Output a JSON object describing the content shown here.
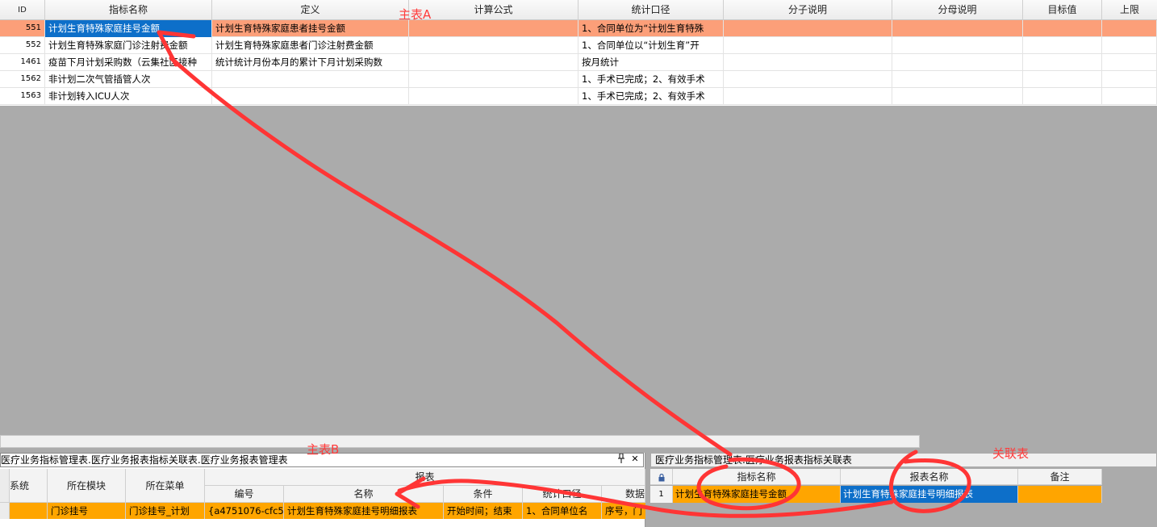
{
  "grid_a": {
    "columns": [
      "ID",
      "指标名称",
      "定义",
      "计算公式",
      "统计口径",
      "分子说明",
      "分母说明",
      "目标值",
      "上限"
    ],
    "rows": [
      {
        "id": "551",
        "name": "计划生育特殊家庭挂号金额",
        "definition": "计划生育特殊家庭患者挂号金额",
        "formula": "",
        "scope": "1、合同单位为“计划生育特殊"
      },
      {
        "id": "552",
        "name": "计划生育特殊家庭门诊注射费金额",
        "definition": "计划生育特殊家庭患者门诊注射费金额",
        "formula": "",
        "scope": "1、合同单位以“计划生育”开"
      },
      {
        "id": "1461",
        "name": "疫苗下月计划采购数（云集社区接种",
        "definition": "统计统计月份本月的累计下月计划采购数",
        "formula": "",
        "scope": "按月统计"
      },
      {
        "id": "1562",
        "name": "非计划二次气管插管人次",
        "definition": "",
        "formula": "",
        "scope": "1、手术已完成；2、有效手术"
      },
      {
        "id": "1563",
        "name": "非计划转入ICU人次",
        "definition": "",
        "formula": "",
        "scope": "1、手术已完成；2、有效手术"
      }
    ]
  },
  "panel_b": {
    "title": "医疗业务指标管理表.医疗业务报表指标关联表.医疗业务报表管理表",
    "pin_icon": "pin-icon",
    "close_label": "✕",
    "group_header": "报表",
    "columns": [
      "系统",
      "所在模块",
      "所在菜单",
      "编号",
      "名称",
      "条件",
      "统计口径",
      "数据"
    ],
    "row": {
      "system": "",
      "module": "门诊挂号",
      "menu": "门诊挂号_计划",
      "code": "{a4751076-cfc5",
      "name": "计划生育特殊家庭挂号明细报表",
      "condition": "开始时间；结束",
      "scope": "1、合同单位名",
      "data": "序号，门"
    }
  },
  "panel_r": {
    "title": "医疗业务指标管理表.医疗业务报表指标关联表",
    "lock_icon": "lock-icon",
    "columns": [
      "指标名称",
      "报表名称",
      "备注"
    ],
    "row": {
      "num": "1",
      "indicator": "计划生育特殊家庭挂号金额",
      "report": "计划生育特殊家庭挂号明细报表",
      "note": ""
    }
  },
  "annotations": {
    "main_a": "主表A",
    "main_b": "主表B",
    "link_table": "关联表"
  },
  "colors": {
    "selected_row": "#fc9f79",
    "focus_cell": "#0d6fc9",
    "orange_row": "#ffa500",
    "annotation": "#ff3b3b"
  }
}
